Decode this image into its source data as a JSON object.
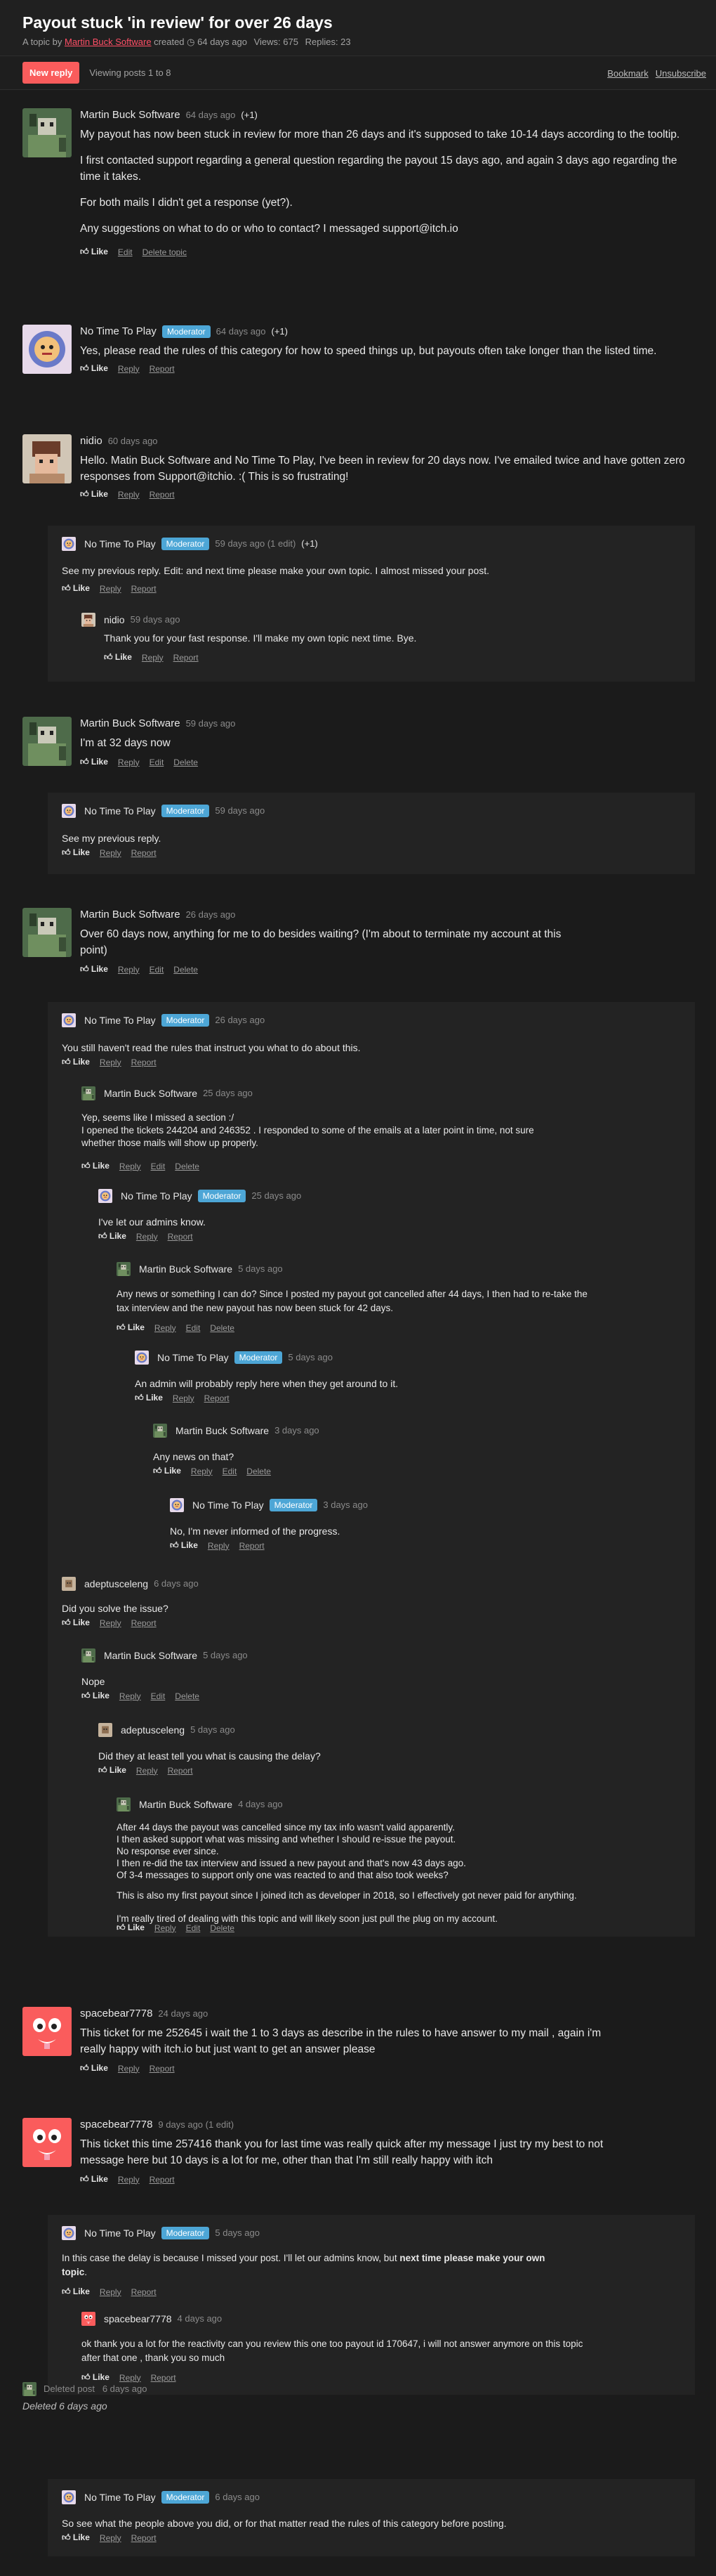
{
  "topic": {
    "title": "Payout stuck 'in review' for over 26 days",
    "by_prefix": "A topic by",
    "author": "Martin Buck Software",
    "created_prefix": "created",
    "created_ago": "64 days ago",
    "views": "Views: 675",
    "replies": "Replies: 23"
  },
  "toolbar": {
    "new_reply": "New reply",
    "viewing": "Viewing posts 1 to 8",
    "bookmark": "Bookmark",
    "unsubscribe": "Unsubscribe"
  },
  "labels": {
    "like": "Like",
    "reply": "Reply",
    "report": "Report",
    "edit": "Edit",
    "delete": "Delete",
    "delete_topic": "Delete topic",
    "moderator": "Moderator"
  },
  "users": {
    "martin": "Martin Buck Software",
    "ntp": "No Time To Play",
    "nidio": "nidio",
    "adept": "adeptusceleng",
    "space": "spacebear7778"
  },
  "posts": {
    "p1": {
      "date": "64 days ago",
      "votes": "(+1)",
      "paras": [
        "My payout has now been stuck in review for more than 26 days and it's supposed to take 10-14 days according to the tooltip.",
        "I first contacted support regarding a general question regarding the payout 15 days ago, and again 3 days ago regarding the time it takes.",
        "For both mails I didn't get a response (yet?).",
        "Any suggestions on what to do or who to contact? I messaged support@itch.io"
      ]
    },
    "p2": {
      "date": "64 days ago",
      "votes": "(+1)",
      "text": "Yes, please read the rules of this category for how to speed things up, but payouts often take longer than the listed time."
    },
    "p3": {
      "date": "60 days ago",
      "text": "Hello. Matin Buck Software and No Time To Play, I've been in review for 20 days now. I've emailed twice and have gotten zero responses from Support@itchio. :( This is so frustrating!"
    },
    "p3r1": {
      "date": "59 days ago (1 edit)",
      "votes": "(+1)",
      "text": "See my previous reply. Edit: and next time please make your own topic. I almost missed your post."
    },
    "p3r2": {
      "date": "59 days ago",
      "text": "Thank you for your fast response. I'll make my own topic next time. Bye."
    },
    "p4": {
      "date": "59 days ago",
      "text": "I'm at 32 days now"
    },
    "p4r1": {
      "date": "59 days ago",
      "text": "See my previous reply."
    },
    "p5": {
      "date": "26 days ago",
      "text": "Over 60 days now, anything for me to do besides waiting? (I'm about to terminate my account at this point)"
    },
    "p5r1": {
      "date": "26 days ago",
      "text": "You still haven't read the rules that instruct you what to do about this."
    },
    "p5r2": {
      "date": "25 days ago",
      "lines": [
        "Yep, seems like I missed a section :/",
        "I opened the tickets 244204 and 246352 . I responded to some of the emails at a later point in time, not sure whether those mails will show up properly."
      ]
    },
    "p5r3": {
      "date": "25 days ago",
      "text": "I've let our admins know."
    },
    "p5r4": {
      "date": "5 days ago",
      "text": "Any news or something I can do? Since I posted my payout got cancelled after 44 days, I then had to re-take the tax interview and the new payout has now been stuck for 42 days."
    },
    "p5r5": {
      "date": "5 days ago",
      "text": "An admin will probably reply here when they get around to it."
    },
    "p5r6": {
      "date": "3 days ago",
      "text": "Any news on that?"
    },
    "p5r7": {
      "date": "3 days ago",
      "text": "No, I'm never informed of the progress."
    },
    "p5r8": {
      "date": "6 days ago",
      "text": "Did you solve the issue?"
    },
    "p5r9": {
      "date": "5 days ago",
      "text": "Nope"
    },
    "p5r10": {
      "date": "5 days ago",
      "text": "Did they at least tell you what is causing the delay?"
    },
    "p5r11": {
      "date": "4 days ago",
      "lines": [
        "After 44 days the payout was cancelled since my tax info wasn't valid apparently.",
        "I then asked support what was missing and whether I should re-issue the payout.",
        "No response ever since.",
        "I then re-did the tax interview and issued a new payout and that's now 43 days ago.",
        "Of 3-4 messages to support only one was reacted to and that also took weeks?"
      ],
      "p2": "This is also my first payout since I joined itch as developer in 2018, so I effectively got never paid for anything.",
      "p3": "I'm really tired of dealing with this topic and will likely soon just pull the plug on my account."
    },
    "p6": {
      "date": "24 days ago",
      "text": "This ticket for me 252645 i wait the 1 to 3 days as describe in the rules to have answer to my mail , again i'm really happy with  itch.io but just want to get an answer please"
    },
    "p7": {
      "date": "9 days ago (1 edit)",
      "text": "This ticket this time 257416 thank you for last time was really quick after my message I just try my best to not message here but 10 days is a lot for me, other than that  I'm still really happy with itch"
    },
    "p7r1": {
      "date": "5 days ago",
      "text_a": "In this case the delay is because I missed your post. I'll let our admins know, but ",
      "text_b": "next time please make your own topic",
      "text_c": "."
    },
    "p7r2": {
      "date": "4 days ago",
      "text": "ok thank you a lot for the reactivity can you review this one too payout id 170647, i will not answer anymore on this topic after that one , thank you so much"
    },
    "p8": {
      "label": "Deleted post",
      "date": "6 days ago",
      "deleted": "Deleted 6 days ago"
    },
    "p8r1": {
      "date": "6 days ago",
      "text": "So see what the people above you did, or for that matter read the rules of this category before posting."
    }
  },
  "colors": {
    "accent": "#fa5c5c",
    "moderator": "#4da6d6",
    "background": "#1b1b1b"
  }
}
